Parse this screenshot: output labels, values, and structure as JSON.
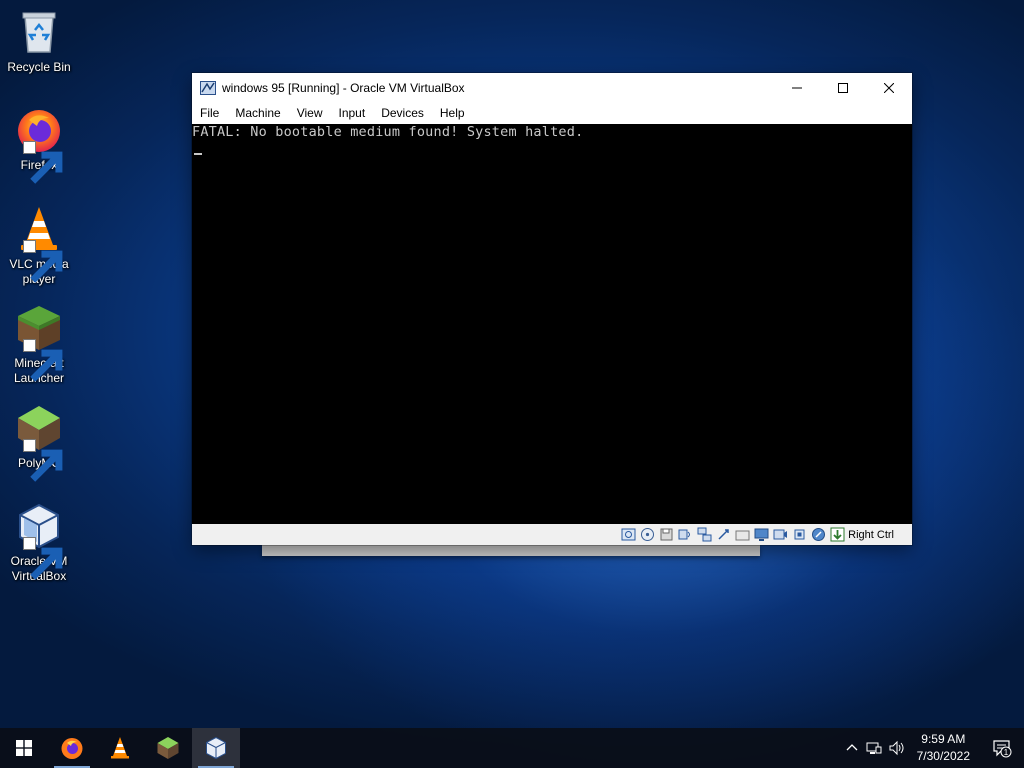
{
  "desktop": {
    "icons": [
      {
        "label": "Recycle Bin",
        "icon": "recycle-bin-icon"
      },
      {
        "label": "Firefox",
        "icon": "firefox-icon"
      },
      {
        "label": "VLC media player",
        "icon": "vlc-icon"
      },
      {
        "label": "Minecraft Launcher",
        "icon": "minecraft-icon"
      },
      {
        "label": "PolyMC",
        "icon": "polymc-icon"
      },
      {
        "label": "Oracle VM VirtualBox",
        "icon": "virtualbox-icon"
      }
    ]
  },
  "window": {
    "title": "windows 95 [Running] - Oracle VM VirtualBox",
    "menu": [
      "File",
      "Machine",
      "View",
      "Input",
      "Devices",
      "Help"
    ],
    "screen_text": "FATAL: No bootable medium found! System halted.",
    "host_key": "Right Ctrl"
  },
  "taskbar": {
    "apps": [
      "firefox-icon",
      "vlc-icon",
      "polymc-icon",
      "virtualbox-icon"
    ],
    "time": "9:59 AM",
    "date": "7/30/2022",
    "notification_count": "1"
  },
  "colors": {
    "desktop_blue": "#0a3a86",
    "taskbar": "#0a0e18",
    "vm_screen": "#000000",
    "vm_text": "#c8c8c8"
  }
}
